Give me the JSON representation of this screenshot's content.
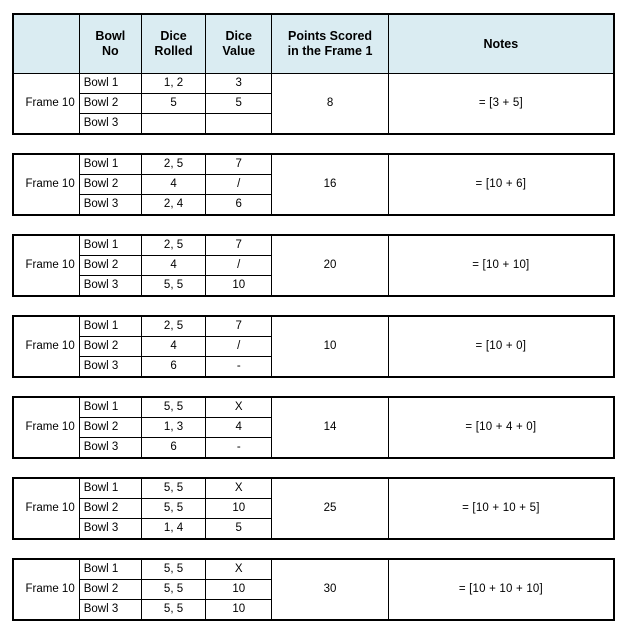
{
  "table": {
    "headers": {
      "blank": "",
      "bowl_no": "Bowl\nNo",
      "bowl_no_line1": "Bowl",
      "bowl_no_line2": "No",
      "dice_rolled_line1": "Dice",
      "dice_rolled_line2": "Rolled",
      "dice_value_line1": "Dice",
      "dice_value_line2": "Value",
      "points_line1": "Points Scored",
      "points_line2": "in the Frame 1",
      "notes": "Notes"
    },
    "header_bg_color": "#daecf2",
    "border_color": "#000000",
    "blocks": [
      {
        "frame_label": "Frame 10",
        "points": "8",
        "notes": "= [3 + 5]",
        "rows": [
          {
            "bowl": "Bowl 1",
            "dice_rolled": "1, 2",
            "dice_value": "3"
          },
          {
            "bowl": "Bowl 2",
            "dice_rolled": "5",
            "dice_value": "5"
          },
          {
            "bowl": "Bowl 3",
            "dice_rolled": "",
            "dice_value": ""
          }
        ]
      },
      {
        "frame_label": "Frame 10",
        "points": "16",
        "notes": "= [10 + 6]",
        "rows": [
          {
            "bowl": "Bowl 1",
            "dice_rolled": "2, 5",
            "dice_value": "7"
          },
          {
            "bowl": "Bowl 2",
            "dice_rolled": "4",
            "dice_value": "/"
          },
          {
            "bowl": "Bowl 3",
            "dice_rolled": "2, 4",
            "dice_value": "6"
          }
        ]
      },
      {
        "frame_label": "Frame 10",
        "points": "20",
        "notes": "= [10 + 10]",
        "rows": [
          {
            "bowl": "Bowl 1",
            "dice_rolled": "2, 5",
            "dice_value": "7"
          },
          {
            "bowl": "Bowl 2",
            "dice_rolled": "4",
            "dice_value": "/"
          },
          {
            "bowl": "Bowl 3",
            "dice_rolled": "5, 5",
            "dice_value": "10"
          }
        ]
      },
      {
        "frame_label": "Frame 10",
        "points": "10",
        "notes": "= [10 + 0]",
        "rows": [
          {
            "bowl": "Bowl 1",
            "dice_rolled": "2, 5",
            "dice_value": "7"
          },
          {
            "bowl": "Bowl 2",
            "dice_rolled": "4",
            "dice_value": "/"
          },
          {
            "bowl": "Bowl 3",
            "dice_rolled": "6",
            "dice_value": "-"
          }
        ]
      },
      {
        "frame_label": "Frame 10",
        "points": "14",
        "notes": "= [10 + 4 + 0]",
        "rows": [
          {
            "bowl": "Bowl 1",
            "dice_rolled": "5, 5",
            "dice_value": "X"
          },
          {
            "bowl": "Bowl 2",
            "dice_rolled": "1, 3",
            "dice_value": "4"
          },
          {
            "bowl": "Bowl 3",
            "dice_rolled": "6",
            "dice_value": "-"
          }
        ]
      },
      {
        "frame_label": "Frame 10",
        "points": "25",
        "notes": "= [10 + 10 + 5]",
        "rows": [
          {
            "bowl": "Bowl 1",
            "dice_rolled": "5, 5",
            "dice_value": "X"
          },
          {
            "bowl": "Bowl 2",
            "dice_rolled": "5, 5",
            "dice_value": "10"
          },
          {
            "bowl": "Bowl 3",
            "dice_rolled": "1, 4",
            "dice_value": "5"
          }
        ]
      },
      {
        "frame_label": "Frame 10",
        "points": "30",
        "notes": "= [10 + 10 + 10]",
        "rows": [
          {
            "bowl": "Bowl 1",
            "dice_rolled": "5, 5",
            "dice_value": "X"
          },
          {
            "bowl": "Bowl 2",
            "dice_rolled": "5, 5",
            "dice_value": "10"
          },
          {
            "bowl": "Bowl 3",
            "dice_rolled": "5, 5",
            "dice_value": "10"
          }
        ]
      }
    ]
  }
}
